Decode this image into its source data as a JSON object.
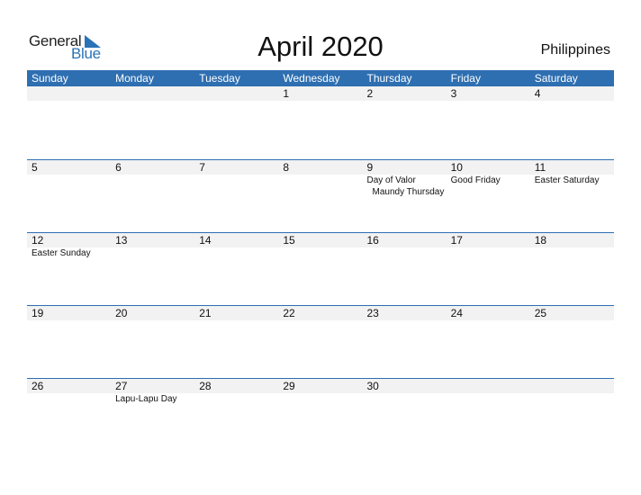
{
  "logo": {
    "line1": "General",
    "line2": "Blue"
  },
  "title": "April 2020",
  "country": "Philippines",
  "colors": {
    "accent": "#2e6fb1",
    "strip": "#f2f2f2"
  },
  "weekdays": [
    "Sunday",
    "Monday",
    "Tuesday",
    "Wednesday",
    "Thursday",
    "Friday",
    "Saturday"
  ],
  "weeks": [
    [
      {
        "day": ""
      },
      {
        "day": ""
      },
      {
        "day": ""
      },
      {
        "day": "1"
      },
      {
        "day": "2"
      },
      {
        "day": "3"
      },
      {
        "day": "4"
      }
    ],
    [
      {
        "day": "5"
      },
      {
        "day": "6"
      },
      {
        "day": "7"
      },
      {
        "day": "8"
      },
      {
        "day": "9",
        "events": [
          "Day of Valor",
          "Maundy Thursday"
        ]
      },
      {
        "day": "10",
        "events": [
          "Good Friday"
        ]
      },
      {
        "day": "11",
        "events": [
          "Easter Saturday"
        ]
      }
    ],
    [
      {
        "day": "12",
        "events": [
          "Easter Sunday"
        ]
      },
      {
        "day": "13"
      },
      {
        "day": "14"
      },
      {
        "day": "15"
      },
      {
        "day": "16"
      },
      {
        "day": "17"
      },
      {
        "day": "18"
      }
    ],
    [
      {
        "day": "19"
      },
      {
        "day": "20"
      },
      {
        "day": "21"
      },
      {
        "day": "22"
      },
      {
        "day": "23"
      },
      {
        "day": "24"
      },
      {
        "day": "25"
      }
    ],
    [
      {
        "day": "26"
      },
      {
        "day": "27",
        "events": [
          "Lapu-Lapu Day"
        ]
      },
      {
        "day": "28"
      },
      {
        "day": "29"
      },
      {
        "day": "30"
      },
      {
        "day": ""
      },
      {
        "day": ""
      }
    ]
  ]
}
